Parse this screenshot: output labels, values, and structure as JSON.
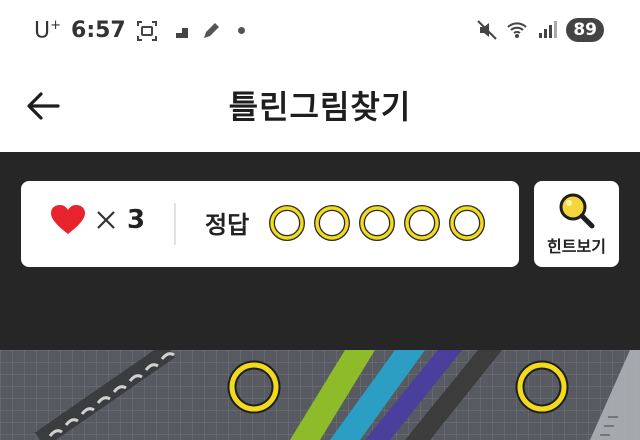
{
  "status_bar": {
    "carrier": "U",
    "carrier_sup": "+",
    "time": "6:57",
    "battery": "89"
  },
  "header": {
    "title": "틀린그림찾기"
  },
  "game": {
    "lives_count": "3",
    "answer_label": "정답",
    "answers_found": 0,
    "answers_total": 5,
    "hint_label": "힌트보기"
  },
  "colors": {
    "panel": "#262626",
    "heart": "#e8232e",
    "ring_fill": "#f2da1c",
    "ring_stroke": "#2a2a2a",
    "hint_lens": "#f5d63a"
  },
  "icons": {
    "back": "arrow-left-icon",
    "heart": "heart-icon",
    "times": "multiply-icon",
    "hint": "magnifier-icon",
    "ring": "answer-ring-icon"
  },
  "puzzle": {
    "found_markers": 2
  }
}
